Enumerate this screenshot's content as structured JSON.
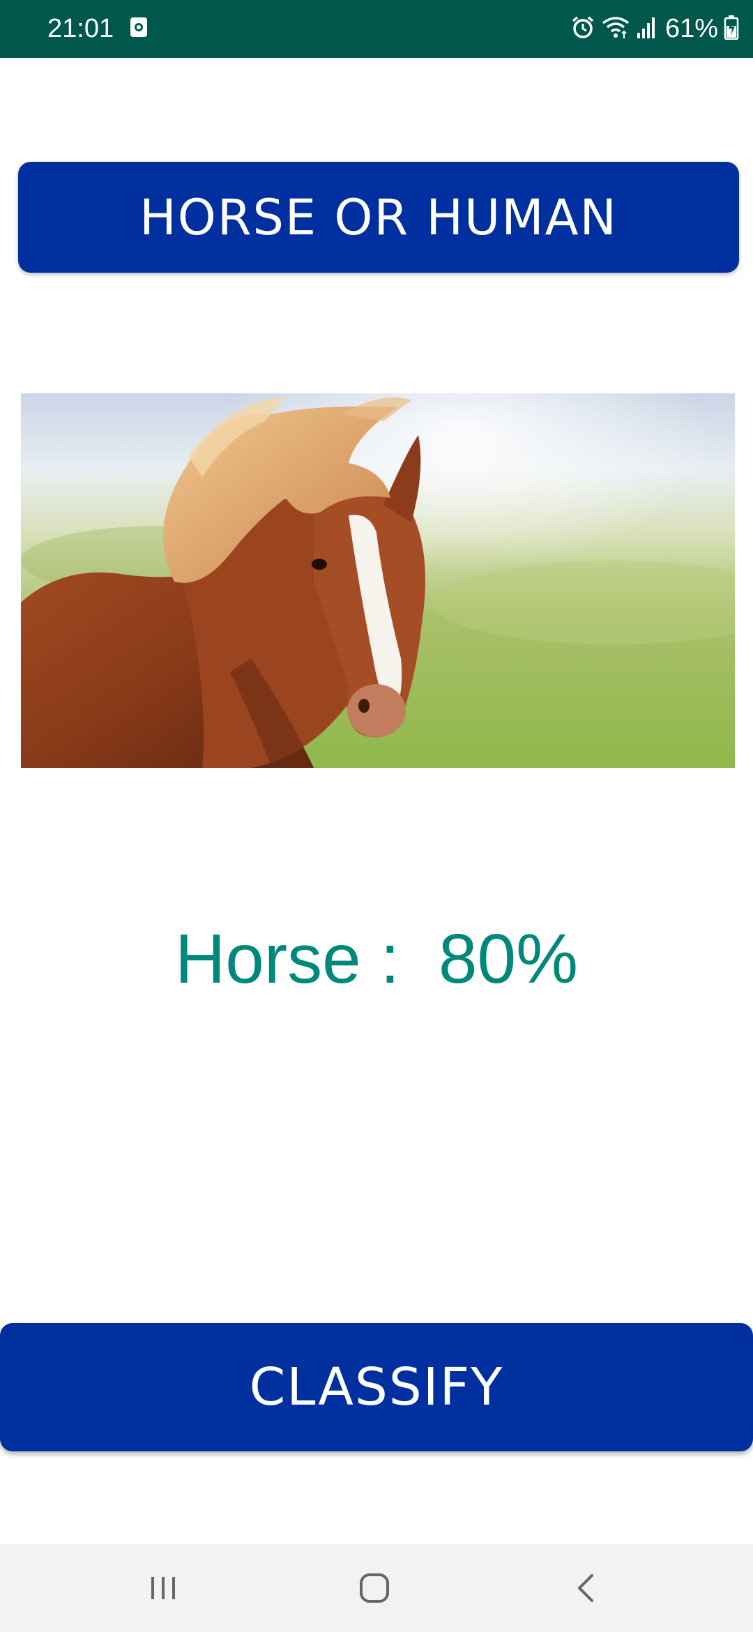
{
  "status_bar": {
    "time": "21:01",
    "battery_percent": "61%",
    "background_color": "#00574b",
    "icons": [
      "notification-icon",
      "alarm-icon",
      "wifi-icon",
      "signal-icon",
      "battery-charging-icon"
    ]
  },
  "app": {
    "title": "HORSE OR HUMAN",
    "image_icon": "horse-photo",
    "result_text": "Horse :  80%",
    "classify_label": "CLASSIFY",
    "accent_color": "#0030a0",
    "result_color": "#00897b"
  },
  "nav_bar": {
    "icons": [
      "recents-icon",
      "home-icon",
      "back-icon"
    ]
  }
}
